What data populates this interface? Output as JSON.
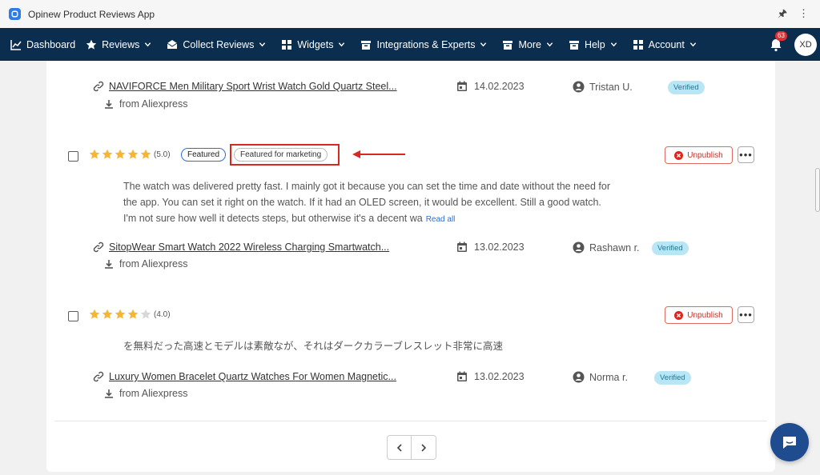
{
  "window": {
    "title": "Opinew Product Reviews App"
  },
  "nav": {
    "items": [
      {
        "label": "Dashboard",
        "icon": "chart-icon"
      },
      {
        "label": "Reviews",
        "icon": "star-icon"
      },
      {
        "label": "Collect Reviews",
        "icon": "envelope-icon"
      },
      {
        "label": "Widgets",
        "icon": "grid-icon"
      },
      {
        "label": "Integrations & Experts",
        "icon": "box-icon"
      },
      {
        "label": "More",
        "icon": "box-icon"
      },
      {
        "label": "Help",
        "icon": "box-icon"
      },
      {
        "label": "Account",
        "icon": "grid-icon"
      }
    ],
    "notifications_count": "63",
    "avatar_initials": "XD"
  },
  "reviews": [
    {
      "product": "NAVIFORCE Men Military Sport Wrist Watch Gold Quartz Steel...",
      "source": "from Aliexpress",
      "date": "14.02.2023",
      "author": "Tristan U.",
      "verified_label": "Verified"
    },
    {
      "rating": 5,
      "rating_text": "(5.0)",
      "featured_label": "Featured",
      "marketing_label": "Featured for marketing",
      "unpublish_label": "Unpublish",
      "text_lines": [
        "The watch was delivered pretty fast. I mainly got it because you can set the time and date without the need for",
        "the app. You can set it right on the watch. If it had an OLED screen, it would be excellent. Still a good watch.",
        "I'm not sure how well it detects steps, but otherwise it's a decent wa"
      ],
      "read_all_label": "Read all",
      "product": "SitopWear Smart Watch 2022 Wireless Charging Smartwatch...",
      "source": "from Aliexpress",
      "date": "13.02.2023",
      "author": "Rashawn r.",
      "verified_label": "Verified"
    },
    {
      "rating": 4,
      "rating_text": "(4.0)",
      "unpublish_label": "Unpublish",
      "text_lines": [
        "を無料だった高速とモデルは素敵なが、それはダークカラーブレスレット非常に高速"
      ],
      "product": "Luxury Women Bracelet Quartz Watches For Women Magnetic...",
      "source": "from Aliexpress",
      "date": "13.02.2023",
      "author": "Norma r.",
      "verified_label": "Verified"
    }
  ],
  "colors": {
    "nav_bg": "#0b2d4e",
    "accent": "#2b6fd6",
    "star": "#f5b731",
    "annotation": "#d9291f"
  }
}
